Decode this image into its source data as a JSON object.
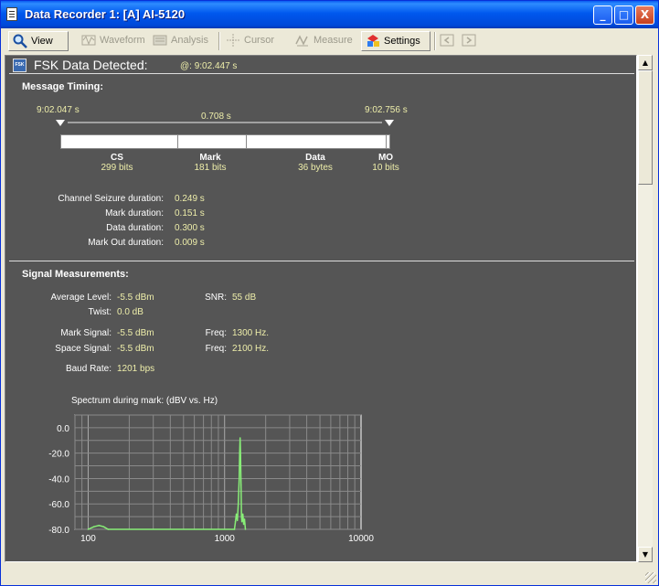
{
  "window": {
    "title": "Data Recorder 1:  [A] AI-5120",
    "controls": [
      "_",
      "□",
      "X"
    ]
  },
  "toolbar": [
    {
      "label": "View",
      "icon": "magnifier-icon",
      "enabled": true
    },
    {
      "label": "Waveform",
      "icon": "waveform-icon",
      "enabled": false
    },
    {
      "label": "Analysis",
      "icon": "analysis-icon",
      "enabled": false
    },
    {
      "label": "Cursor",
      "icon": "cursor-icon",
      "enabled": false
    },
    {
      "label": "Measure",
      "icon": "measure-icon",
      "enabled": false
    },
    {
      "label": "Settings",
      "icon": "settings-icon",
      "enabled": true
    }
  ],
  "header": {
    "badge": "FSK",
    "title": "FSK Data Detected:",
    "time": "@: 9:02.447 s"
  },
  "timing": {
    "heading": "Message Timing:",
    "start": "9:02.047 s",
    "end": "9:02.756 s",
    "span": "0.708 s",
    "segments": [
      {
        "name": "CS",
        "value": "299 bits"
      },
      {
        "name": "Mark",
        "value": "181 bits"
      },
      {
        "name": "Data",
        "value": "36 bytes"
      },
      {
        "name": "MO",
        "value": "10 bits"
      }
    ],
    "durations": [
      {
        "label": "Channel Seizure duration:",
        "value": "0.249 s"
      },
      {
        "label": "Mark duration:",
        "value": "0.151 s"
      },
      {
        "label": "Data duration:",
        "value": "0.300 s"
      },
      {
        "label": "Mark Out duration:",
        "value": "0.009 s"
      }
    ]
  },
  "signal": {
    "heading": "Signal Measurements:",
    "avg_label": "Average Level:",
    "avg_value": "-5.5 dBm",
    "snr_label": "SNR:",
    "snr_value": "55 dB",
    "twist_label": "Twist:",
    "twist_value": "0.0 dB",
    "mark_label": "Mark Signal:",
    "mark_value": "-5.5 dBm",
    "mark_freq_label": "Freq:",
    "mark_freq_value": "1300 Hz.",
    "space_label": "Space Signal:",
    "space_value": "-5.5 dBm",
    "space_freq_label": "Freq:",
    "space_freq_value": "2100 Hz.",
    "baud_label": "Baud Rate:",
    "baud_value": "1201 bps"
  },
  "chart_data": {
    "type": "line",
    "title": "Spectrum during mark: (dBV vs. Hz)",
    "xlabel": "",
    "ylabel": "",
    "x_scale": "log",
    "xlim": [
      80,
      10000
    ],
    "ylim": [
      -80,
      10
    ],
    "x_ticks": [
      "100",
      "1000",
      "10000"
    ],
    "y_ticks": [
      "0.0",
      "-20.0",
      "-40.0",
      "-60.0",
      "-80.0"
    ],
    "grid": true,
    "series": [
      {
        "color": "#88ee77",
        "x": [
          100,
          110,
          120,
          130,
          140,
          1180,
          1200,
          1220,
          1240,
          1260,
          1280,
          1290,
          1300,
          1310,
          1320,
          1330,
          1340,
          1360,
          1380,
          1400,
          1420
        ],
        "y": [
          -80,
          -78,
          -77,
          -78,
          -80,
          -80,
          -74,
          -68,
          -73,
          -60,
          -40,
          -20,
          -8,
          -22,
          -45,
          -70,
          -74,
          -68,
          -76,
          -72,
          -80
        ]
      }
    ]
  }
}
